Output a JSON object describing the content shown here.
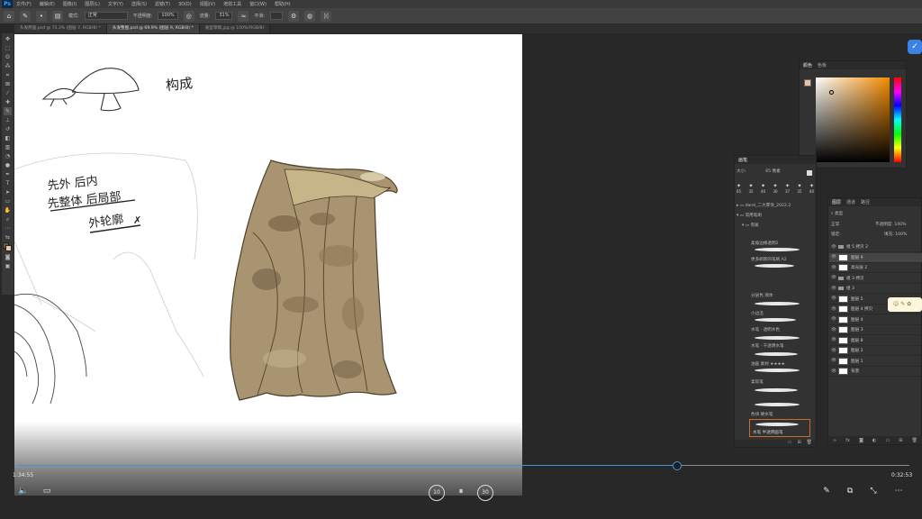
{
  "menubar": {
    "logo": "Ps",
    "items": [
      "文件(F)",
      "编辑(E)",
      "图像(I)",
      "图层(L)",
      "文字(Y)",
      "选择(S)",
      "滤镜(T)",
      "3D(D)",
      "视图(V)",
      "增效工具",
      "窗口(W)",
      "帮助(H)"
    ]
  },
  "options": {
    "mode_label": "模式:",
    "mode_value": "正常",
    "opacity_label": "不透明度:",
    "opacity_value": "100%",
    "flow_label": "流量:",
    "flow_value": "31%",
    "smooth_label": "平滑:"
  },
  "doc_tabs": [
    "头发原画.psd @ 73.3% (图层 7, RGB/8) *",
    "头发整图.psd @ 69.9% (图层 9, RGB/8) *",
    "发型草稿.jpg @ 100%(RGB/8)"
  ],
  "canvas": {
    "note_title": "构成",
    "note_line1": "先外 后内",
    "note_line2": "先整体 后局部",
    "note_line3": "外轮廓"
  },
  "color_panel": {
    "tabs": [
      "颜色",
      "色板"
    ]
  },
  "brush_panel": {
    "tab": "画笔",
    "size_label": "大小:",
    "size_value": "65 像素",
    "brush_sizes": [
      "65",
      "35",
      "40",
      "30",
      "37",
      "35",
      "40"
    ],
    "groups": [
      {
        "label": "darel_二大厚涂_2022.2"
      },
      {
        "label": "常用笔刷"
      },
      {
        "label": "有斑"
      }
    ],
    "items": [
      "柔角边缘透明2",
      "更多刷新的笔刷 A2",
      "分层色 液体",
      "小边沿",
      "水笔 · 透明水色",
      "水笔 · 干透明水笔",
      "油画 素材 ★★★★",
      "柔软笔",
      "色块 硬水笔",
      "水笔 半透明画笔"
    ]
  },
  "layers_panel": {
    "tabs": [
      "图层",
      "通道",
      "路径"
    ],
    "filter_label": "类型",
    "blend_value": "正常",
    "opacity_label": "不透明度:",
    "opacity_value": "100%",
    "lock_label": "锁定:",
    "fill_label": "填充:",
    "fill_value": "100%",
    "layers": [
      {
        "name": "组 5 拷贝 2",
        "kind": "group"
      },
      {
        "name": "图层 9",
        "kind": "layer",
        "selected": true
      },
      {
        "name": "高光层 2",
        "kind": "layer"
      },
      {
        "name": "组 3 拷贝",
        "kind": "group"
      },
      {
        "name": "组 3",
        "kind": "group"
      },
      {
        "name": "图层 5",
        "kind": "layer"
      },
      {
        "name": "图层 4 拷贝",
        "kind": "layer"
      },
      {
        "name": "图层 4",
        "kind": "layer"
      },
      {
        "name": "图层 3",
        "kind": "layer"
      },
      {
        "name": "图层 8",
        "kind": "layer"
      },
      {
        "name": "图层 2",
        "kind": "layer"
      },
      {
        "name": "图层 1",
        "kind": "layer"
      },
      {
        "name": "背景",
        "kind": "layer"
      }
    ]
  },
  "video": {
    "elapsed": "1:34:55",
    "total": "0:32:53",
    "progress": 0.74,
    "skip_back": "10",
    "skip_fwd": "30"
  },
  "colors": {
    "accent": "#3c94e4",
    "hair_base": "#a89470",
    "hair_dark": "#7a6448"
  }
}
